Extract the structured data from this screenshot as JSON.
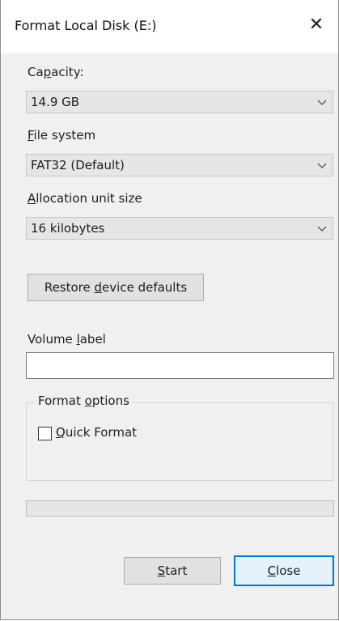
{
  "window": {
    "title": "Format Local Disk (E:)",
    "close_glyph": "✕"
  },
  "capacity": {
    "label_pre": "Ca",
    "label_mnemonic": "p",
    "label_post": "acity:",
    "value": "14.9 GB"
  },
  "file_system": {
    "label_mnemonic": "F",
    "label_post": "ile system",
    "value": "FAT32 (Default)"
  },
  "allocation": {
    "label_mnemonic": "A",
    "label_post": "llocation unit size",
    "value": "16 kilobytes"
  },
  "restore_button": {
    "label_pre": "Restore ",
    "label_mnemonic": "d",
    "label_post": "evice defaults"
  },
  "volume_label": {
    "label_pre": "Volume ",
    "label_mnemonic": "l",
    "label_post": "abel",
    "value": "",
    "placeholder": ""
  },
  "format_options": {
    "legend_pre": "Format ",
    "legend_mnemonic": "o",
    "legend_post": "ptions",
    "quick_format": {
      "label_mnemonic": "Q",
      "label_post": "uick Format",
      "checked": false
    }
  },
  "progress": {
    "value_percent": 0
  },
  "start_button": {
    "label_mnemonic": "S",
    "label_post": "tart"
  },
  "close_button": {
    "label_mnemonic": "C",
    "label_post": "lose"
  },
  "icons": {
    "dropdown": "chevron-down-icon",
    "close": "close-icon"
  },
  "colors": {
    "focus_border": "#0078d7",
    "dialog_bg": "#f0f0f0"
  }
}
